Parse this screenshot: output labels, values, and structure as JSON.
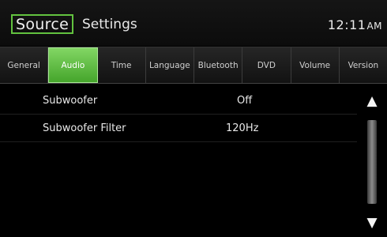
{
  "header": {
    "source_label": "Source",
    "title": "Settings",
    "clock_time": "12:11",
    "clock_ampm": "AM"
  },
  "tabs": [
    {
      "label": "General",
      "active": false
    },
    {
      "label": "Audio",
      "active": true
    },
    {
      "label": "Time",
      "active": false
    },
    {
      "label": "Language",
      "active": false
    },
    {
      "label": "Bluetooth",
      "active": false
    },
    {
      "label": "DVD",
      "active": false
    },
    {
      "label": "Volume",
      "active": false
    },
    {
      "label": "Version",
      "active": false
    }
  ],
  "settings": [
    {
      "label": "Subwoofer",
      "value": "Off"
    },
    {
      "label": "Subwoofer Filter",
      "value": "120Hz"
    }
  ],
  "scroll": {
    "up_icon": "up-arrow-icon",
    "down_icon": "down-arrow-icon"
  },
  "colors": {
    "accent": "#5cc23a",
    "background": "#000000"
  }
}
